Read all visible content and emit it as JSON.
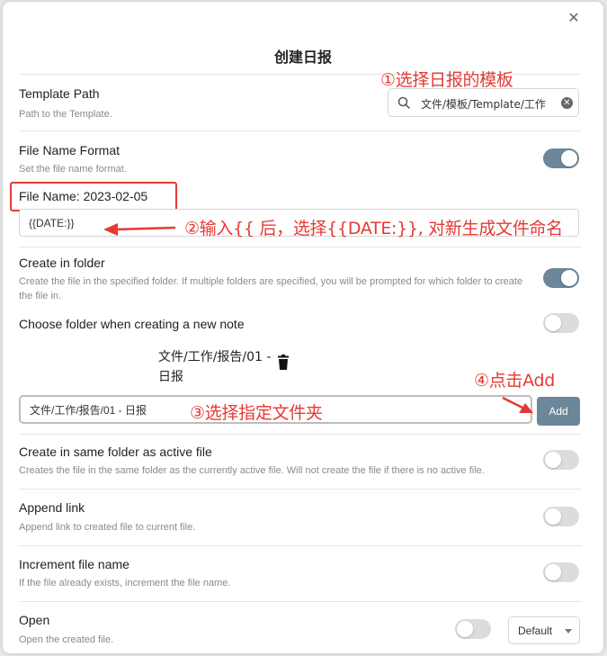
{
  "modal": {
    "title": "创建日报",
    "close_glyph": "✕"
  },
  "settings": {
    "template_path": {
      "label": "Template Path",
      "desc": "Path to the Template.",
      "value": "文件/模板/Template/工作"
    },
    "file_name_format": {
      "label": "File Name Format",
      "desc": "Set the file name format.",
      "enabled": true,
      "preview": "File Name: 2023-02-05",
      "value": "{{DATE:}}"
    },
    "create_in_folder": {
      "label": "Create in folder",
      "desc": "Create the file in the specified folder. If multiple folders are specified, you will be prompted for which folder to create the file in.",
      "enabled": true
    },
    "choose_folder": {
      "label": "Choose folder when creating a new note",
      "enabled": false
    },
    "folder_list": {
      "entry": "文件/工作/报告/01 - 日报",
      "input_value": "文件/工作/报告/01 - 日报",
      "add_label": "Add"
    },
    "same_folder": {
      "label": "Create in same folder as active file",
      "desc": "Creates the file in the same folder as the currently active file. Will not create the file if there is no active file.",
      "enabled": false
    },
    "append_link": {
      "label": "Append link",
      "desc": "Append link to created file to current file.",
      "enabled": false
    },
    "increment_name": {
      "label": "Increment file name",
      "desc": "If the file already exists, increment the file name.",
      "enabled": false
    },
    "open": {
      "label": "Open",
      "desc": "Open the created file.",
      "enabled": false,
      "mode": "Default"
    }
  },
  "annotations": {
    "step1": "①选择日报的模板",
    "step2": "②输入{{ 后，选择{{DATE:}}, 对新生成文件命名",
    "step3": "③选择指定文件夹",
    "step4": "④点击Add"
  },
  "colors": {
    "annotation_red": "#e53935",
    "toggle_on": "#6b8799",
    "toggle_off": "#dcdcdc",
    "add_button": "#6b8799"
  }
}
